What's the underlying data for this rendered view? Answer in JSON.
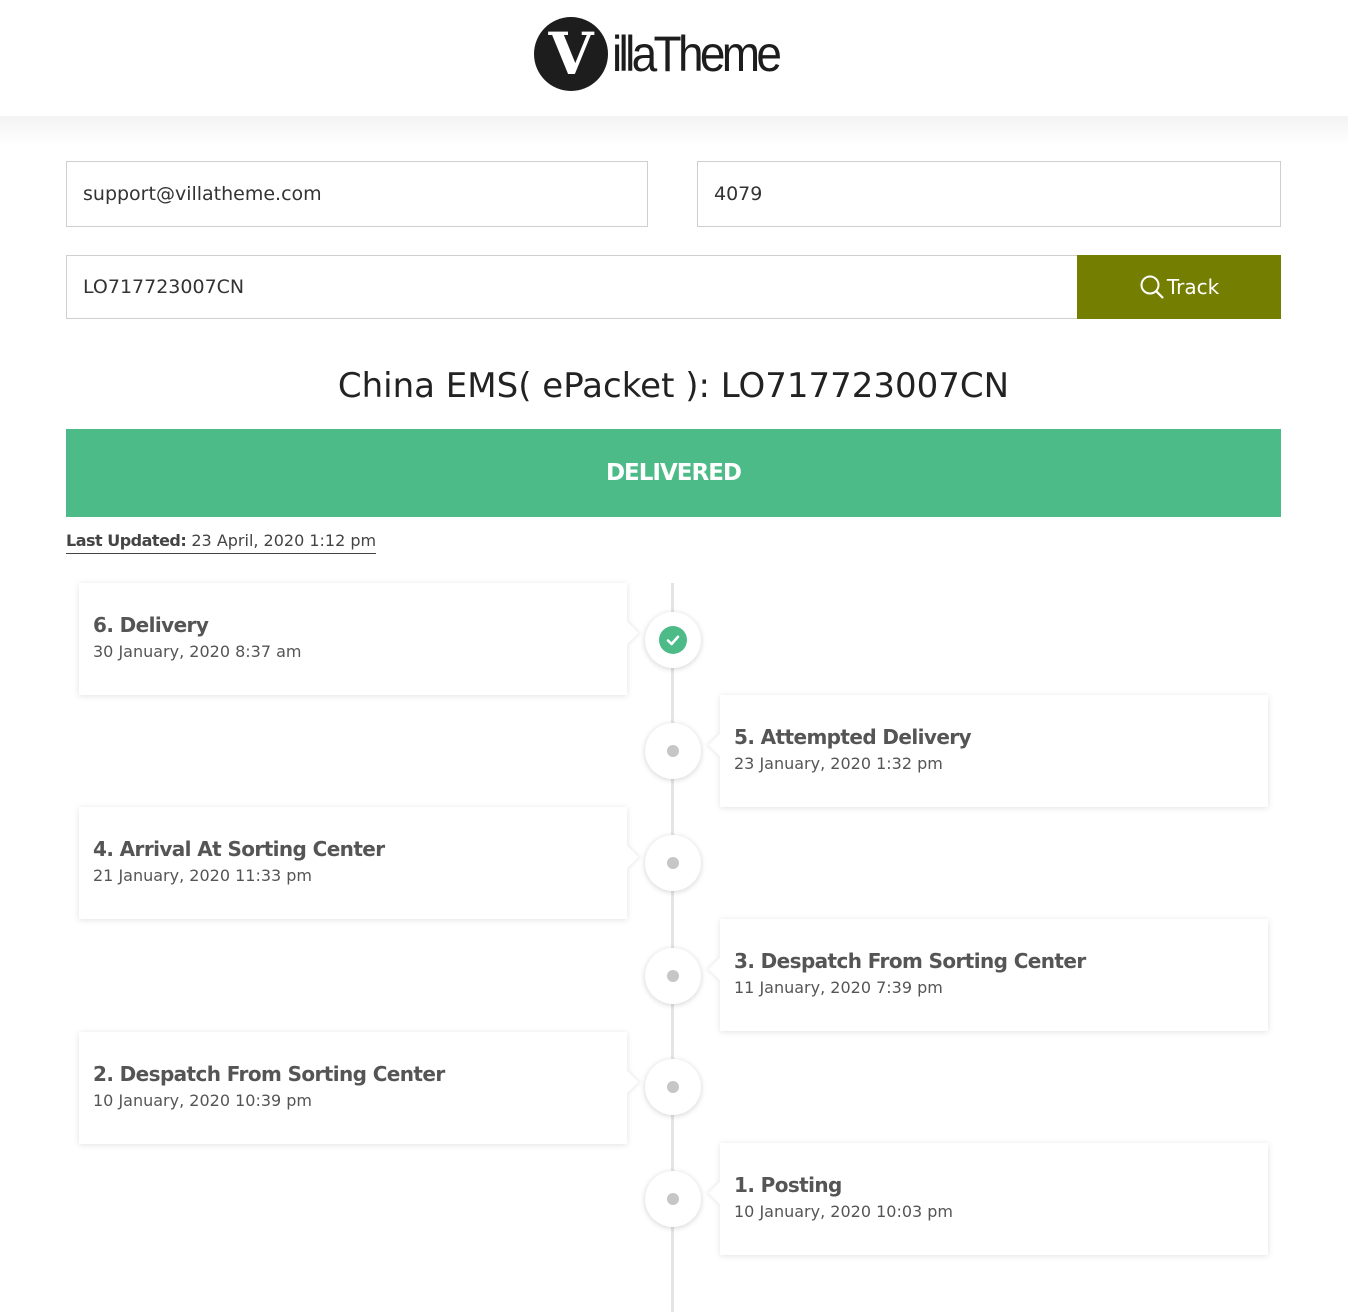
{
  "header": {
    "logo_letter": "V",
    "logo_text": "illaTheme"
  },
  "form": {
    "email_value": "support@villatheme.com",
    "order_value": "4079",
    "tracking_value": "LO717723007CN",
    "track_label": "Track"
  },
  "result": {
    "title": "China EMS( ePacket ): LO717723007CN",
    "status": "DELIVERED",
    "last_updated_label": "Last Updated:",
    "last_updated_value": " 23 April, 2020 1:12 pm"
  },
  "timeline": [
    {
      "title": "6. Delivery",
      "time": "30 January, 2020 8:37 am",
      "side": "left",
      "completed": true
    },
    {
      "title": "5. Attempted Delivery",
      "time": "23 January, 2020 1:32 pm",
      "side": "right",
      "completed": false
    },
    {
      "title": "4. Arrival At Sorting Center",
      "time": "21 January, 2020 11:33 pm",
      "side": "left",
      "completed": false
    },
    {
      "title": "3. Despatch From Sorting Center",
      "time": "11 January, 2020 7:39 pm",
      "side": "right",
      "completed": false
    },
    {
      "title": "2. Despatch From Sorting Center",
      "time": "10 January, 2020 10:39 pm",
      "side": "left",
      "completed": false
    },
    {
      "title": "1. Posting",
      "time": "10 January, 2020 10:03 pm",
      "side": "right",
      "completed": false
    }
  ],
  "colors": {
    "track_button": "#747e01",
    "status_delivered": "#4cbb88"
  },
  "icons": {
    "track": "search-icon",
    "completed_node": "check-circle-icon",
    "pending_node": "dot-icon"
  }
}
